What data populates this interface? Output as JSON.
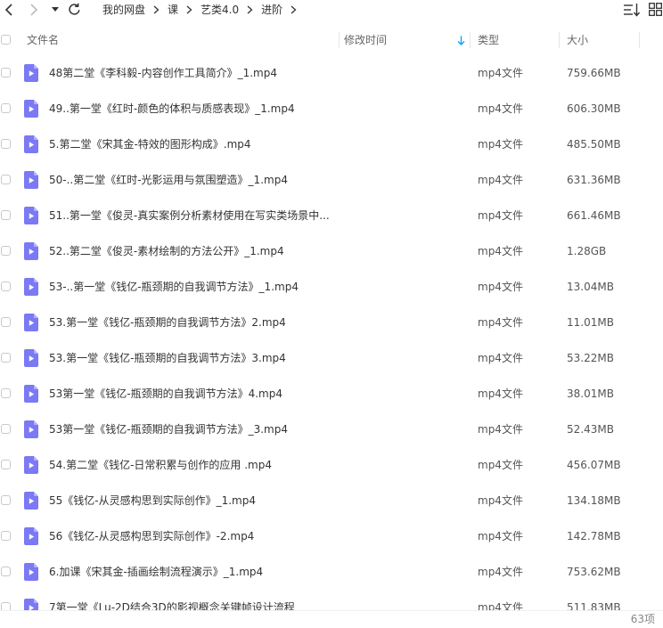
{
  "toolbar": {
    "icons": {
      "back": "back-icon",
      "forward": "forward-icon",
      "history": "dropdown-icon",
      "refresh": "refresh-icon",
      "sort": "sort-list-icon",
      "view": "grid-view-icon"
    }
  },
  "breadcrumb": {
    "items": [
      "我的网盘",
      "课",
      "艺类4.0",
      "进阶"
    ]
  },
  "columns": {
    "name": "文件名",
    "modified": "修改时间",
    "type": "类型",
    "size": "大小"
  },
  "sort": {
    "column": "修改时间",
    "icon": "arrow-down-icon"
  },
  "files": [
    {
      "name": "48第二堂《李科毅-内容创作工具简介》_1.mp4",
      "type": "mp4文件",
      "size": "759.66MB"
    },
    {
      "name": "49..第一堂《红时-颜色的体积与质感表现》_1.mp4",
      "type": "mp4文件",
      "size": "606.30MB"
    },
    {
      "name": "5.第二堂《宋其金-特效的图形构成》.mp4",
      "type": "mp4文件",
      "size": "485.50MB"
    },
    {
      "name": "50-..第二堂《红时-光影运用与氛围塑造》_1.mp4",
      "type": "mp4文件",
      "size": "631.36MB"
    },
    {
      "name": "51..第一堂《俊灵-真实案例分析素材使用在写实类场景中...",
      "type": "mp4文件",
      "size": "661.46MB"
    },
    {
      "name": "52..第二堂《俊灵-素材绘制的方法公开》_1.mp4",
      "type": "mp4文件",
      "size": "1.28GB"
    },
    {
      "name": "53-..第一堂《钱亿-瓶颈期的自我调节方法》_1.mp4",
      "type": "mp4文件",
      "size": "13.04MB"
    },
    {
      "name": "53.第一堂《钱亿-瓶颈期的自我调节方法》2.mp4",
      "type": "mp4文件",
      "size": "11.01MB"
    },
    {
      "name": "53.第一堂《钱亿-瓶颈期的自我调节方法》3.mp4",
      "type": "mp4文件",
      "size": "53.22MB"
    },
    {
      "name": "53第一堂《钱亿-瓶颈期的自我调节方法》4.mp4",
      "type": "mp4文件",
      "size": "38.01MB"
    },
    {
      "name": "53第一堂《钱亿-瓶颈期的自我调节方法》_3.mp4",
      "type": "mp4文件",
      "size": "52.43MB"
    },
    {
      "name": "54.第二堂《钱亿-日常积累与创作的应用 .mp4",
      "type": "mp4文件",
      "size": "456.07MB"
    },
    {
      "name": "55《钱亿-从灵感构思到实际创作》_1.mp4",
      "type": "mp4文件",
      "size": "134.18MB"
    },
    {
      "name": "56《钱亿-从灵感构思到实际创作》-2.mp4",
      "type": "mp4文件",
      "size": "142.78MB"
    },
    {
      "name": "6.加课《宋其金-插画绘制流程演示》_1.mp4",
      "type": "mp4文件",
      "size": "753.62MB"
    },
    {
      "name": "7第一堂《Lu-2D结合3D的影视概念关键帧设计流程",
      "type": "mp4文件",
      "size": "511.83MB"
    }
  ],
  "file_icon": "video-file-icon",
  "footer": {
    "count": "63项"
  },
  "colors": {
    "accent": "#06a7ff",
    "file_icon": "#7b79f3",
    "text": "#333333",
    "muted": "#666666"
  }
}
